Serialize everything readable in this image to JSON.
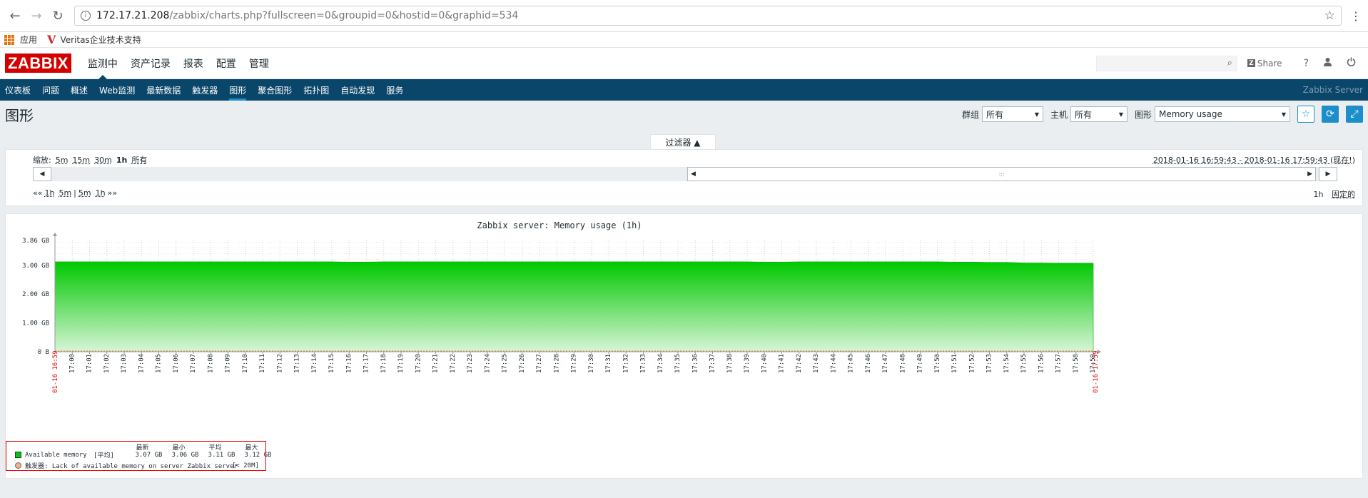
{
  "browser": {
    "url_host": "172.17.21.208",
    "url_path": "/zabbix/charts.php?fullscreen=0&groupid=0&hostid=0&graphid=534",
    "bookmarks": [
      {
        "label": "应用"
      },
      {
        "label": "Veritas企业技术支持"
      }
    ]
  },
  "header": {
    "logo": "ZABBIX",
    "menu": [
      {
        "label": "监测中",
        "active": true
      },
      {
        "label": "资产记录"
      },
      {
        "label": "报表"
      },
      {
        "label": "配置"
      },
      {
        "label": "管理"
      }
    ],
    "share_label": "Share",
    "help_label": "?"
  },
  "subnav": {
    "items": [
      {
        "label": "仪表板"
      },
      {
        "label": "问题"
      },
      {
        "label": "概述"
      },
      {
        "label": "Web监测"
      },
      {
        "label": "最新数据"
      },
      {
        "label": "触发器"
      },
      {
        "label": "图形",
        "active": true
      },
      {
        "label": "聚合图形"
      },
      {
        "label": "拓扑图"
      },
      {
        "label": "自动发现"
      },
      {
        "label": "服务"
      }
    ],
    "server_name": "Zabbix Server"
  },
  "page": {
    "title": "图形",
    "group_label": "群组",
    "group_value": "所有",
    "host_label": "主机",
    "host_value": "所有",
    "graph_label": "图形",
    "graph_value": "Memory usage"
  },
  "filter": {
    "tab_label": "过滤器 ▲",
    "zoom_label": "缩放:",
    "zoom_options": [
      "5m",
      "15m",
      "30m",
      "1h",
      "所有"
    ],
    "range_text": "2018-01-16 16:59:43 - 2018-01-16 17:59:43 (现在!)",
    "nav_back": "««",
    "nav_forward": "»»",
    "nav_options": [
      "1h",
      "5m",
      "|",
      "5m",
      "1h"
    ],
    "period": "1h",
    "fixed_label": "固定的"
  },
  "colors": {
    "brand": "#d40000",
    "subnav_bg": "#0a466a",
    "accent": "#1c8ec9",
    "series_fill": "#00c800"
  },
  "chart_data": {
    "type": "area",
    "title": "Zabbix server: Memory usage (1h)",
    "y_unit": "GB",
    "y_ticks": [
      "3.86 GB",
      "3.00 GB",
      "2.00 GB",
      "1.00 GB",
      "0 B"
    ],
    "ylim": [
      0,
      3.86
    ],
    "x_start_label": "01-16 16:59",
    "x_end_label": "01-16 17:59",
    "x_ticks": [
      "17:00",
      "17:01",
      "17:02",
      "17:03",
      "17:04",
      "17:05",
      "17:06",
      "17:07",
      "17:08",
      "17:09",
      "17:10",
      "17:11",
      "17:12",
      "17:13",
      "17:14",
      "17:15",
      "17:16",
      "17:17",
      "17:18",
      "17:19",
      "17:20",
      "17:21",
      "17:22",
      "17:23",
      "17:24",
      "17:25",
      "17:26",
      "17:27",
      "17:28",
      "17:29",
      "17:30",
      "17:31",
      "17:32",
      "17:33",
      "17:34",
      "17:35",
      "17:36",
      "17:37",
      "17:38",
      "17:39",
      "17:40",
      "17:41",
      "17:42",
      "17:43",
      "17:44",
      "17:45",
      "17:46",
      "17:47",
      "17:48",
      "17:49",
      "17:50",
      "17:51",
      "17:52",
      "17:53",
      "17:54",
      "17:55",
      "17:56",
      "17:57",
      "17:58",
      "17:59"
    ],
    "series": [
      {
        "name": "Available memory",
        "values": [
          3.12,
          3.12,
          3.12,
          3.12,
          3.12,
          3.12,
          3.12,
          3.12,
          3.12,
          3.12,
          3.12,
          3.12,
          3.12,
          3.12,
          3.12,
          3.12,
          3.11,
          3.11,
          3.12,
          3.12,
          3.12,
          3.12,
          3.12,
          3.12,
          3.12,
          3.12,
          3.12,
          3.12,
          3.12,
          3.12,
          3.12,
          3.12,
          3.12,
          3.12,
          3.12,
          3.12,
          3.12,
          3.12,
          3.12,
          3.12,
          3.11,
          3.11,
          3.12,
          3.12,
          3.12,
          3.12,
          3.12,
          3.12,
          3.12,
          3.12,
          3.12,
          3.11,
          3.11,
          3.1,
          3.1,
          3.08,
          3.08,
          3.07,
          3.07,
          3.07
        ]
      }
    ],
    "legend": {
      "headers": [
        "最新",
        "最小",
        "平均",
        "最大"
      ],
      "series_row": {
        "name": "Available memory",
        "func": "[平均]",
        "last": "3.07 GB",
        "min": "3.06 GB",
        "avg": "3.11 GB",
        "max": "3.12 GB"
      },
      "trigger_row": {
        "text": "触发器: Lack of available memory on server Zabbix server",
        "condition": "[< 20M]"
      }
    },
    "grid": true
  }
}
